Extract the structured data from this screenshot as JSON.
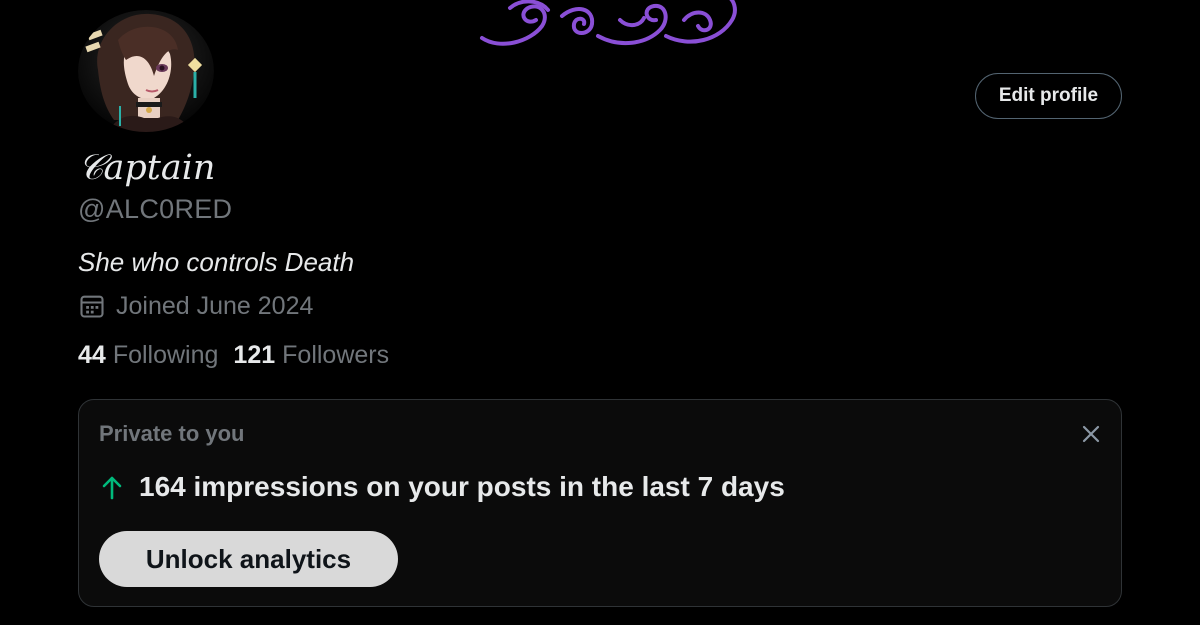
{
  "profile": {
    "display_name": "𝒞aptain",
    "handle": "@ALC0RED",
    "bio": "She who controls Death",
    "joined": "Joined June 2024",
    "edit_label": "Edit profile"
  },
  "stats": {
    "following_count": "44",
    "following_label": "Following",
    "followers_count": "121",
    "followers_label": "Followers"
  },
  "private_card": {
    "title": "Private to you",
    "impressions_text": "164 impressions on your posts in the last 7 days",
    "unlock_label": "Unlock analytics"
  },
  "icons": {
    "calendar": "calendar-icon",
    "close": "close-icon",
    "arrow": "arrow-up-icon",
    "banner": "purple-cloud-ornament"
  },
  "colors": {
    "background": "#000000",
    "primary_text": "#e7e9ea",
    "secondary_text": "#71767b",
    "accent_green": "#00ba7c",
    "banner_purple": "#8a4fd6",
    "button_light": "#d9d9d9"
  }
}
